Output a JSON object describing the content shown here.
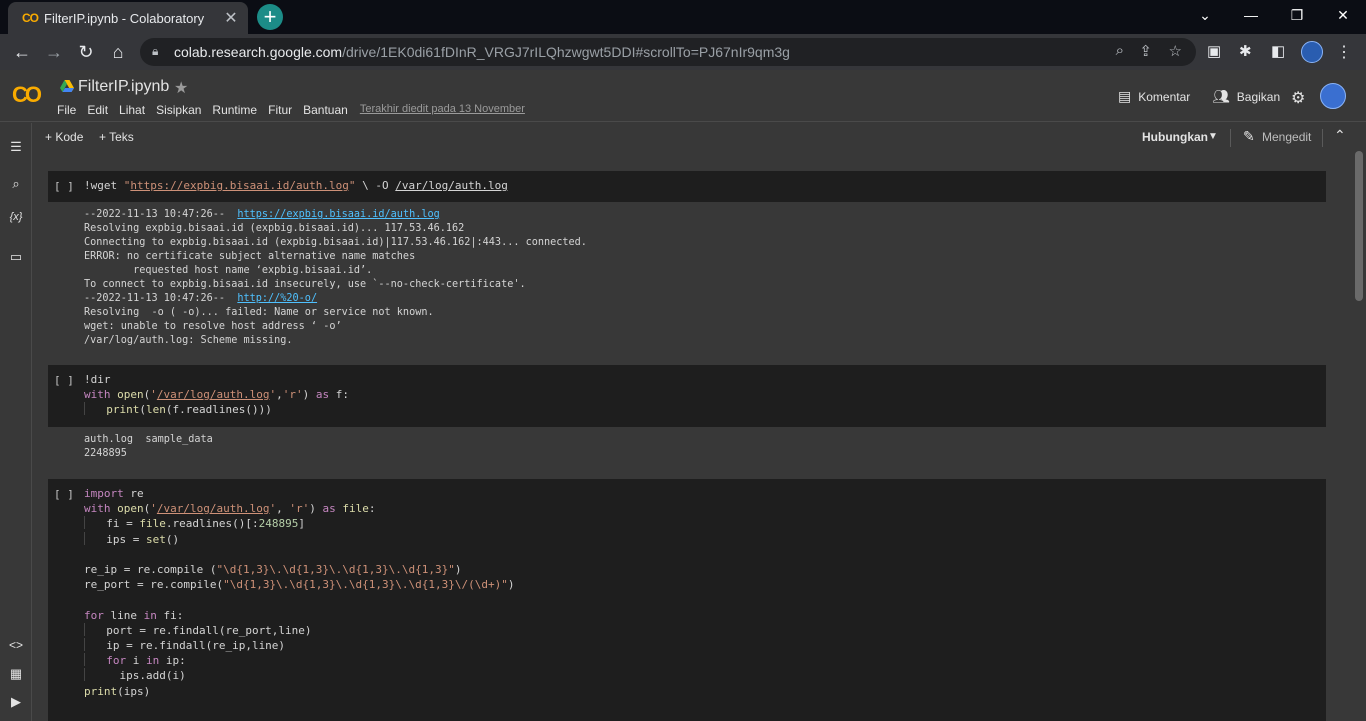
{
  "browser": {
    "tab_title": "FilterIP.ipynb - Colaboratory",
    "tab_favicon": "CO",
    "url_host": "colab.research.google.com",
    "url_path": "/drive/1EK0di61fDInR_VRGJ7rILQhzwgwt5DDI#scrollTo=PJ67nIr9qm3g",
    "close_glyph": "✕",
    "newtab_glyph": "+"
  },
  "colab": {
    "logo": "CO",
    "title": "FilterIP.ipynb",
    "menu": [
      "File",
      "Edit",
      "Lihat",
      "Sisipkan",
      "Runtime",
      "Fitur",
      "Bantuan"
    ],
    "last_edited": "Terakhir diedit pada 13 November",
    "comment_label": "Komentar",
    "share_label": "Bagikan"
  },
  "toolbar": {
    "add_code": "+ Kode",
    "add_text": "+ Teks",
    "connect": "Hubungkan",
    "editing": "Mengedit"
  },
  "cells": [
    {
      "brackets": "[ ]",
      "output": [
        "--2022-11-13 10:47:26--  ",
        "Resolving expbig.bisaai.id (expbig.bisaai.id)... 117.53.46.162",
        "Connecting to expbig.bisaai.id (expbig.bisaai.id)|117.53.46.162|:443... connected.",
        "ERROR: no certificate subject alternative name matches",
        "        requested host name ‘expbig.bisaai.id’.",
        "To connect to expbig.bisaai.id insecurely, use `--no-check-certificate'.",
        "--2022-11-13 10:47:26--  ",
        "Resolving  -o ( -o)... failed: Name or service not known.",
        "wget: unable to resolve host address ‘ -o’",
        "/var/log/auth.log: Scheme missing."
      ],
      "output_links": [
        "https://expbig.bisaai.id/auth.log",
        "http://%20-o/"
      ]
    },
    {
      "brackets": "[ ]",
      "output": [
        "auth.log  sample_data",
        "2248895"
      ]
    },
    {
      "brackets": "[ ]"
    }
  ]
}
